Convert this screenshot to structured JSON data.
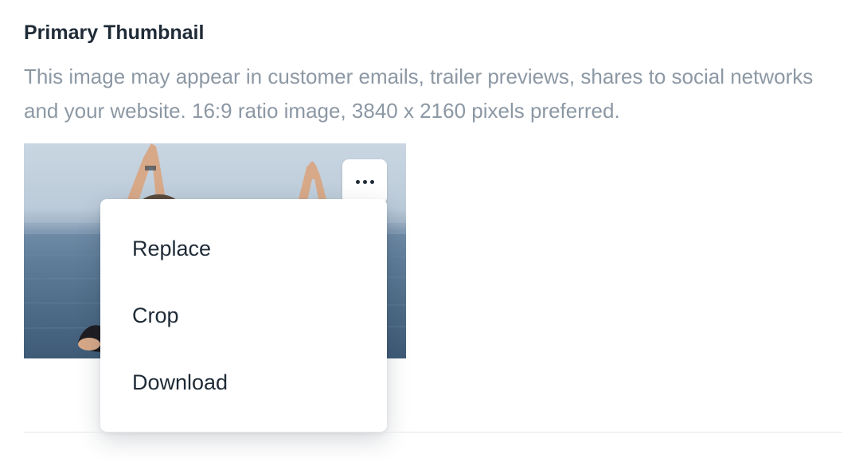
{
  "section": {
    "title": "Primary Thumbnail",
    "description": "This image may appear in customer emails, trailer previews, shares to social networks and your website. 16:9 ratio image, 3840 x 2160 pixels preferred."
  },
  "thumbnail": {
    "icon": "more-horizontal-icon"
  },
  "menu": {
    "items": [
      {
        "label": "Replace"
      },
      {
        "label": "Crop"
      },
      {
        "label": "Download"
      }
    ]
  }
}
